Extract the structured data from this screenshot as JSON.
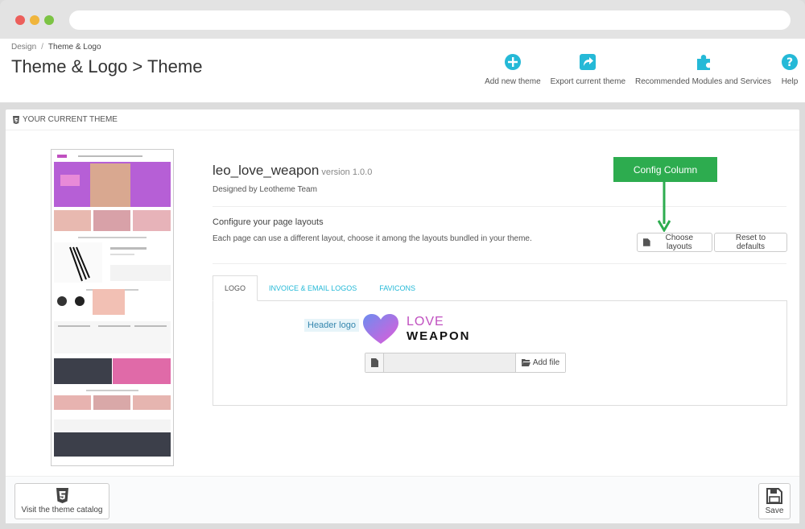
{
  "breadcrumb": {
    "parent": "Design",
    "separator": "/",
    "current": "Theme & Logo"
  },
  "page_title": "Theme & Logo > Theme",
  "toolbar": {
    "add_theme": "Add new theme",
    "export_theme": "Export current theme",
    "recommended": "Recommended Modules and Services",
    "help": "Help"
  },
  "panel": {
    "heading": "YOUR CURRENT THEME",
    "theme_name": "leo_love_weapon",
    "theme_version": "version 1.0.0",
    "designed_by": "Designed by Leotheme Team",
    "layouts_title": "Configure your page layouts",
    "layouts_desc": "Each page can use a different layout, choose it among the layouts bundled in your theme.",
    "choose_layouts": "Choose layouts",
    "reset_defaults": "Reset to defaults",
    "callout": "Config Column"
  },
  "tabs": [
    {
      "label": "LOGO",
      "active": true
    },
    {
      "label": "INVOICE & EMAIL LOGOS",
      "active": false
    },
    {
      "label": "FAVICONS",
      "active": false
    }
  ],
  "logo_tab": {
    "header_logo_label": "Header logo",
    "logo_line1": "LOVE",
    "logo_line2": "WEAPON",
    "add_file": "Add file"
  },
  "footer": {
    "catalog": "Visit the theme catalog",
    "save": "Save"
  },
  "colors": {
    "accent": "#25b9d7",
    "callout": "#2dac4f",
    "logo_pink": "#c050c0"
  }
}
